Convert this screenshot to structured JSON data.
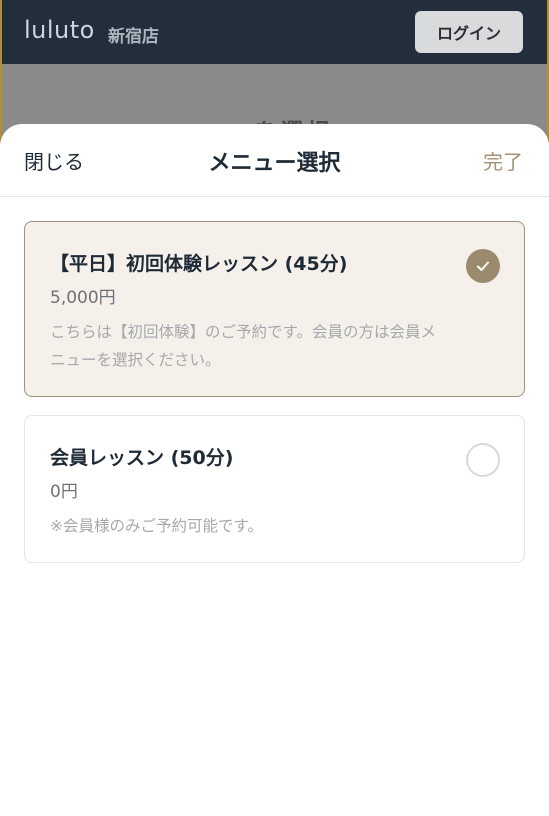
{
  "header": {
    "logo_text": "luluto",
    "store_name": "新宿店",
    "login_label": "ログイン"
  },
  "background": {
    "partial_text": "ニューを選択"
  },
  "sheet": {
    "close_label": "閉じる",
    "title": "メニュー選択",
    "done_label": "完了",
    "items": [
      {
        "title": "【平日】初回体験レッスン (45分)",
        "price": "5,000円",
        "description": "こちらは【初回体験】のご予約です。会員の方は会員メニューを選択ください。",
        "selected": true
      },
      {
        "title": "会員レッスン (50分)",
        "price": "0円",
        "description": "※会員様のみご予約可能です。",
        "selected": false
      }
    ]
  },
  "colors": {
    "header_bg": "#222e3c",
    "accent": "#9b8a6e",
    "selected_card_bg": "#f5f0ea",
    "done_text": "#a59272"
  },
  "icons": {
    "check": "check-icon",
    "radio_empty": "radio-empty-icon"
  }
}
